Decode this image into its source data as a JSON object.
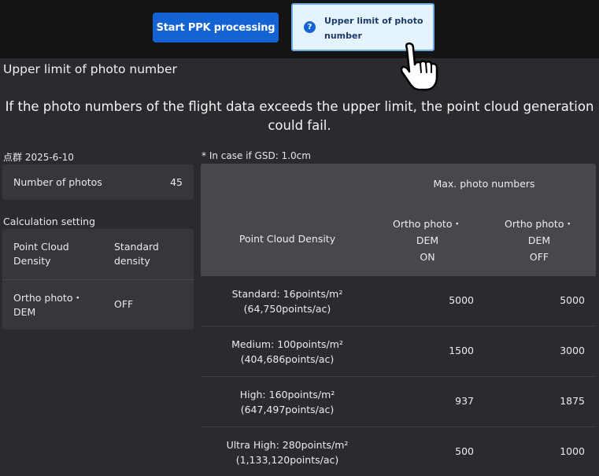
{
  "toolbar": {
    "ppk_label": "Start PPK processing",
    "limit_label": "Upper limit of photo number"
  },
  "section": {
    "title": "Upper limit of photo number",
    "warning": "If the photo numbers of the flight data exceeds the upper limit, the point cloud generation could fail."
  },
  "left": {
    "date_label": "点群 2025-6-10",
    "photos_key": "Number of photos",
    "photos_value": "45",
    "calc_title": "Calculation setting",
    "calc_rows": [
      {
        "key": "Point Cloud Density",
        "value": "Standard density"
      },
      {
        "key": "Ortho photo・DEM",
        "value": "OFF"
      }
    ]
  },
  "table": {
    "note": "* In case if GSD: 1.0cm",
    "header_max": "Max. photo numbers",
    "header_density": "Point Cloud Density",
    "col_on": [
      "Ortho photo・",
      "DEM",
      "ON"
    ],
    "col_off": [
      "Ortho photo・",
      "DEM",
      "OFF"
    ],
    "rows": [
      {
        "line1": "Standard: 16points/m²",
        "line2": "(64,750points/ac)",
        "on": "5000",
        "off": "5000"
      },
      {
        "line1": "Medium: 100points/m²",
        "line2": "(404,686points/ac)",
        "on": "1500",
        "off": "3000"
      },
      {
        "line1": "High: 160points/m²",
        "line2": "(647,497points/ac)",
        "on": "937",
        "off": "1875"
      },
      {
        "line1": "Ultra High: 280points/m²",
        "line2": "(1,133,120points/ac)",
        "on": "500",
        "off": "1000"
      }
    ]
  },
  "icons": {
    "help": "question-circle-icon",
    "pointer": "hand-pointer-icon"
  },
  "colors": {
    "accent": "#1463d2",
    "tooltip_bg": "#e5f3ff"
  }
}
